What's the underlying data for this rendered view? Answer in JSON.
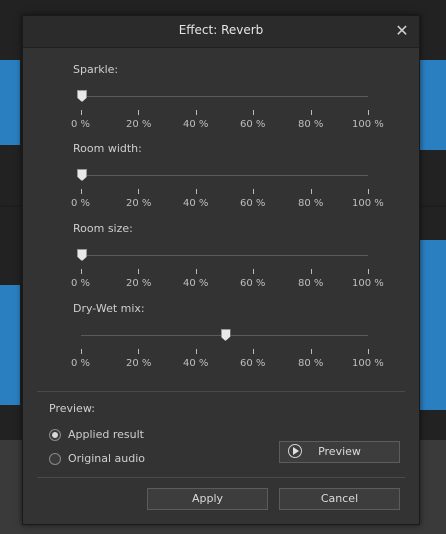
{
  "dialog": {
    "title": "Effect: Reverb",
    "close_icon": "close-icon"
  },
  "sliders": [
    {
      "id": "sparkle",
      "label": "Sparkle:",
      "value_percent": 0
    },
    {
      "id": "room-width",
      "label": "Room width:",
      "value_percent": 0
    },
    {
      "id": "room-size",
      "label": "Room size:",
      "value_percent": 0
    },
    {
      "id": "dry-wet-mix",
      "label": "Dry-Wet mix:",
      "value_percent": 50
    }
  ],
  "tick_labels": [
    "0 %",
    "20 %",
    "40 %",
    "60 %",
    "80 %",
    "100 %"
  ],
  "preview": {
    "label": "Preview:",
    "options": [
      {
        "label": "Applied result",
        "checked": true
      },
      {
        "label": "Original audio",
        "checked": false
      }
    ],
    "button_label": "Preview",
    "button_icon": "play-circle-icon"
  },
  "footer": {
    "apply_label": "Apply",
    "cancel_label": "Cancel"
  },
  "colors": {
    "waveform": "#2a7fc0",
    "dialog_bg": "#333333"
  }
}
